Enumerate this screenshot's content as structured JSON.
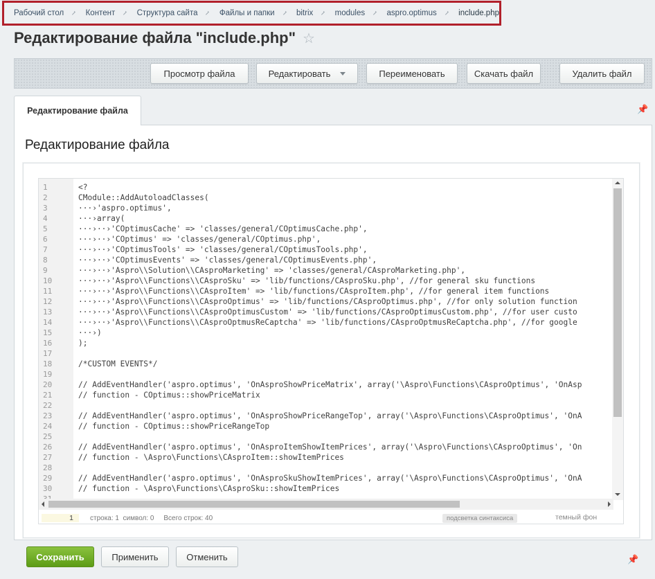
{
  "breadcrumb": [
    "Рабочий стол",
    "Контент",
    "Структура сайта",
    "Файлы и папки",
    "bitrix",
    "modules",
    "aspro.optimus",
    "include.php"
  ],
  "page_title": "Редактирование файла \"include.php\"",
  "toolbar": {
    "view": "Просмотр файла",
    "edit": "Редактировать",
    "rename": "Переименовать",
    "download": "Скачать файл",
    "delete": "Удалить файл"
  },
  "tab_label": "Редактирование файла",
  "section_title": "Редактирование файла",
  "code_lines": [
    "<?",
    "CModule::AddAutoloadClasses(",
    "···›'aspro.optimus',",
    "···›array(",
    "···›··›'COptimusCache' => 'classes/general/COptimusCache.php',",
    "···›··›'COptimus' => 'classes/general/COptimus.php',",
    "···›··›'COptimusTools' => 'classes/general/COptimusTools.php',",
    "···›··›'COptimusEvents' => 'classes/general/COptimusEvents.php',",
    "···›··›'Aspro\\\\Solution\\\\CAsproMarketing' => 'classes/general/CAsproMarketing.php',",
    "···›··›'Aspro\\\\Functions\\\\CAsproSku' => 'lib/functions/CAsproSku.php', //for general sku functions",
    "···›··›'Aspro\\\\Functions\\\\CAsproItem' => 'lib/functions/CAsproItem.php', //for general item functions",
    "···›··›'Aspro\\\\Functions\\\\CAsproOptimus' => 'lib/functions/CAsproOptimus.php', //for only solution function",
    "···›··›'Aspro\\\\Functions\\\\CAsproOptimusCustom' => 'lib/functions/CAsproOptimusCustom.php', //for user custo",
    "···›··›'Aspro\\\\Functions\\\\CAsproOptmusReCaptcha' => 'lib/functions/CAsproOptmusReCaptcha.php', //for google",
    "···›)",
    ");",
    "",
    "/*CUSTOM EVENTS*/",
    "",
    "// AddEventHandler('aspro.optimus', 'OnAsproShowPriceMatrix', array('\\Aspro\\Functions\\CAsproOptimus', 'OnAsp",
    "// function - COptimus::showPriceMatrix",
    "",
    "// AddEventHandler('aspro.optimus', 'OnAsproShowPriceRangeTop', array('\\Aspro\\Functions\\CAsproOptimus', 'OnA",
    "// function - COptimus::showPriceRangeTop",
    "",
    "// AddEventHandler('aspro.optimus', 'OnAsproItemShowItemPrices', array('\\Aspro\\Functions\\CAsproOptimus', 'On",
    "// function - \\Aspro\\Functions\\CAsproItem::showItemPrices",
    "",
    "// AddEventHandler('aspro.optimus', 'OnAsproSkuShowItemPrices', array('\\Aspro\\Functions\\CAsproOptimus', 'OnA",
    "// function - \\Aspro\\Functions\\CAsproSku::showItemPrices",
    ""
  ],
  "status": {
    "line_no": "1",
    "text": "строка: 1  символ: 0     Всего строк: 40",
    "syntax_badge": "подсветка синтаксиса",
    "dark_theme": "темный фон"
  },
  "buttons": {
    "save": "Сохранить",
    "apply": "Применить",
    "cancel": "Отменить"
  }
}
